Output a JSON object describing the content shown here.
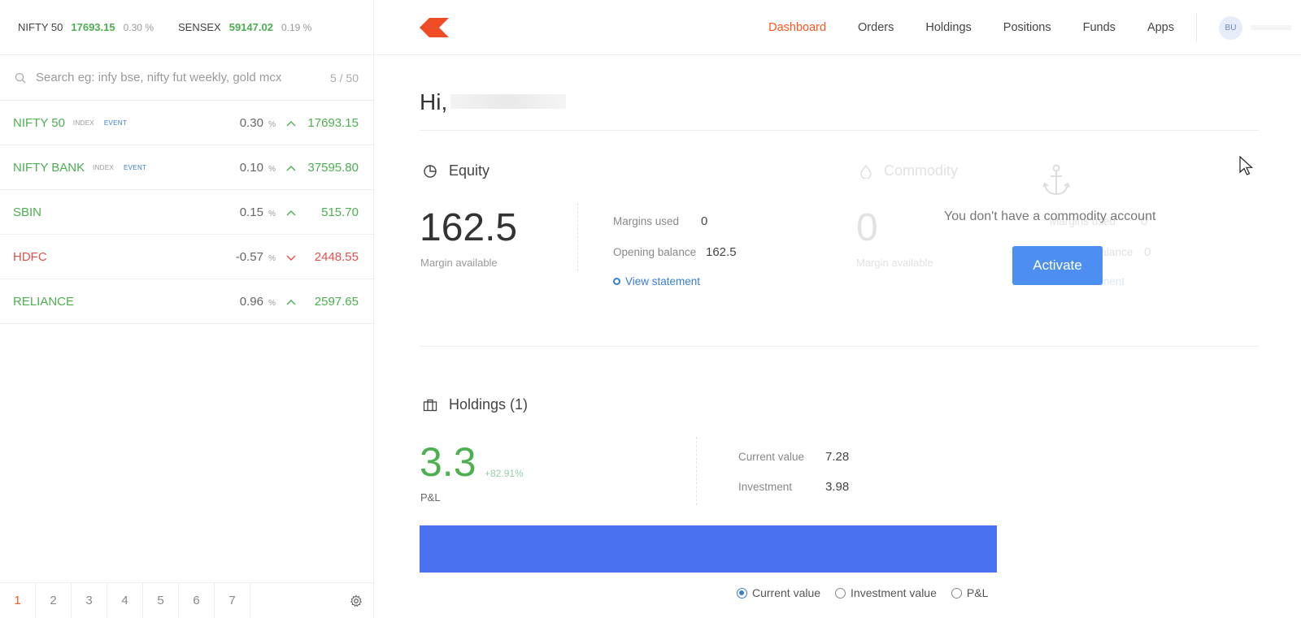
{
  "ticker": [
    {
      "name": "NIFTY 50",
      "value": "17693.15",
      "change": "0.30 %"
    },
    {
      "name": "SENSEX",
      "value": "59147.02",
      "change": "0.19 %"
    }
  ],
  "search": {
    "placeholder": "Search eg: infy bse, nifty fut weekly, gold mcx",
    "count": "5 / 50"
  },
  "watchlist": [
    {
      "symbol": "NIFTY 50",
      "tag1": "INDEX",
      "tag2": "EVENT",
      "change": "0.30",
      "unit": "%",
      "direction": "up",
      "price": "17693.15"
    },
    {
      "symbol": "NIFTY BANK",
      "tag1": "INDEX",
      "tag2": "EVENT",
      "change": "0.10",
      "unit": "%",
      "direction": "up",
      "price": "37595.80"
    },
    {
      "symbol": "SBIN",
      "tag1": "",
      "tag2": "",
      "change": "0.15",
      "unit": "%",
      "direction": "up",
      "price": "515.70"
    },
    {
      "symbol": "HDFC",
      "tag1": "",
      "tag2": "",
      "change": "-0.57",
      "unit": "%",
      "direction": "down",
      "price": "2448.55"
    },
    {
      "symbol": "RELIANCE",
      "tag1": "",
      "tag2": "",
      "change": "0.96",
      "unit": "%",
      "direction": "up",
      "price": "2597.65"
    }
  ],
  "pager": [
    "1",
    "2",
    "3",
    "4",
    "5",
    "6",
    "7"
  ],
  "nav": {
    "items": [
      "Dashboard",
      "Orders",
      "Holdings",
      "Positions",
      "Funds",
      "Apps"
    ],
    "active": "Dashboard",
    "avatar": "BU"
  },
  "greeting": "Hi,",
  "equity": {
    "title": "Equity",
    "margin_available": "162.5",
    "margin_label": "Margin available",
    "margins_used_label": "Margins used",
    "margins_used": "0",
    "opening_balance_label": "Opening balance",
    "opening_balance": "162.5",
    "view_statement": "View statement"
  },
  "commodity": {
    "title": "Commodity",
    "margin_available": "0",
    "margin_label": "Margin available",
    "margins_used_label": "Margins used",
    "margins_used": "0",
    "opening_balance_label": "Opening balance",
    "opening_balance": "0",
    "view_statement": "View statement",
    "message": "You don't have a commodity account",
    "activate": "Activate"
  },
  "holdings": {
    "title": "Holdings (1)",
    "pnl": "3.3",
    "pnl_pct": "+82.91%",
    "pnl_label": "P&L",
    "current_value_label": "Current value",
    "current_value": "7.28",
    "investment_label": "Investment",
    "investment": "3.98",
    "toggle": [
      "Current value",
      "Investment value",
      "P&L"
    ],
    "toggle_selected": "Current value"
  },
  "colors": {
    "accent": "#ff5722",
    "green": "#4caf50",
    "red": "#df514c",
    "blue": "#387ed1",
    "bar": "#4a72f0"
  }
}
